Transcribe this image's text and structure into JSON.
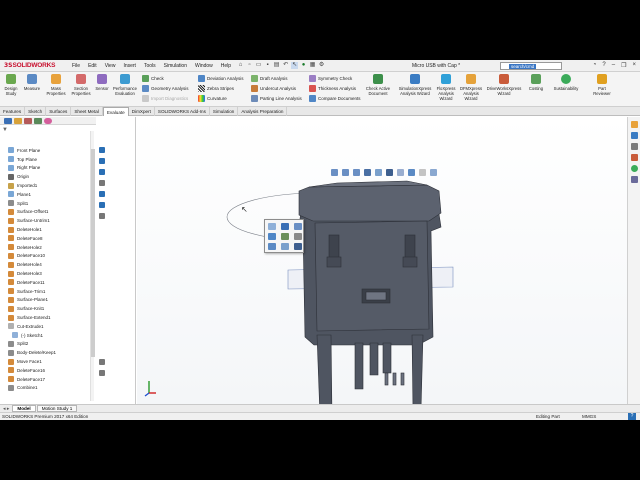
{
  "app": {
    "brand_ds": "3S",
    "brand_name": "SOLIDWORKS",
    "doc_title": "Micro USB with Cap *",
    "search_text": "search/cmd",
    "menu": [
      "File",
      "Edit",
      "View",
      "Insert",
      "Tools",
      "Simulation",
      "Window",
      "Help"
    ]
  },
  "cmdmgr": {
    "design_study": "Design\nStudy",
    "measure": "Measure",
    "mass_properties": "Mass\nProperties",
    "section_properties": "Section\nProperties",
    "sensor": "Sensor",
    "performance_evaluation": "Performance\nEvaluation",
    "check": "Check",
    "geometry_analysis": "Geometry Analysis",
    "import_diagnostics": "Import Diagnostics",
    "deviation_analysis": "Deviation Analysis",
    "zebra_stripes": "Zebra Stripes",
    "curvature": "Curvature",
    "draft_analysis": "Draft Analysis",
    "undercut_analysis": "Undercut Analysis",
    "parting_line_analysis": "Parting Line Analysis",
    "symmetry_check": "Symmetry Check",
    "thickness_analysis": "Thickness Analysis",
    "compare_documents": "Compare Documents",
    "check_active_document": "Check Active\nDocument",
    "simxpress": "SimulationXpress\nAnalysis Wizard",
    "floxpress": "FloXpress\nAnalysis\nWizard",
    "dfmxpress": "DFMXpress\nAnalysis\nWizard",
    "driveworks": "DriveWorksXpress\nWizard",
    "costing": "Costing",
    "sustainability": "Sustainability",
    "part_reviewer": "Part\nReviewer"
  },
  "tabs": [
    "Features",
    "Sketch",
    "Surfaces",
    "Sheet Metal",
    "Evaluate",
    "DimXpert",
    "SOLIDWORKS Add-Ins",
    "Simulation",
    "Analysis Preparation"
  ],
  "active_tab": "Evaluate",
  "tree": [
    {
      "label": "Front Plane",
      "color": "#7aa7d6"
    },
    {
      "label": "Top Plane",
      "color": "#7aa7d6"
    },
    {
      "label": "Right Plane",
      "color": "#7aa7d6"
    },
    {
      "label": "Origin",
      "color": "#666666"
    },
    {
      "label": "Imported1",
      "color": "#c7a24a"
    },
    {
      "label": "Plane1",
      "color": "#7aa7d6"
    },
    {
      "label": "Split1",
      "color": "#8c8c8c"
    },
    {
      "label": "Surface-Offset1",
      "color": "#d48a3a"
    },
    {
      "label": "Surface-Untrim1",
      "color": "#d48a3a"
    },
    {
      "label": "DeleteHole1",
      "color": "#d48a3a"
    },
    {
      "label": "DeleteFace8",
      "color": "#d48a3a"
    },
    {
      "label": "DeleteHole2",
      "color": "#d48a3a"
    },
    {
      "label": "DeleteFace10",
      "color": "#d48a3a"
    },
    {
      "label": "DeleteHole4",
      "color": "#d48a3a"
    },
    {
      "label": "DeleteHole3",
      "color": "#d48a3a"
    },
    {
      "label": "DeleteFace11",
      "color": "#d48a3a"
    },
    {
      "label": "Surface-Trim1",
      "color": "#d48a3a"
    },
    {
      "label": "Surface-Plane1",
      "color": "#d48a3a"
    },
    {
      "label": "Surface-Knit1",
      "color": "#d48a3a"
    },
    {
      "label": "Surface-Extend1",
      "color": "#d48a3a"
    },
    {
      "label": "Cut-Extrude1",
      "color": "#b0b0b0"
    },
    {
      "label": "(-) Sketch1",
      "color": "#8fb0d8"
    },
    {
      "label": "Split2",
      "color": "#8c8c8c"
    },
    {
      "label": "Body-Delete/Keep1",
      "color": "#8c8c8c"
    },
    {
      "label": "Move Face1",
      "color": "#d48a3a"
    },
    {
      "label": "DeleteFace16",
      "color": "#d48a3a"
    },
    {
      "label": "DeleteFace17",
      "color": "#d48a3a"
    },
    {
      "label": "Combine1",
      "color": "#8c8c8c"
    }
  ],
  "bottom_tabs": [
    "Model",
    "Motion Study 1"
  ],
  "active_bottom_tab": "Model",
  "status": {
    "edition": "SOLIDWORKS Premium 2017 x64 Edition",
    "mode": "Editing Part",
    "units": "MMGS",
    "help": "?"
  },
  "colors": {
    "brand_red": "#c8102e",
    "model_gray": "#4f5561",
    "plane_blue": "#7a8fbf"
  }
}
